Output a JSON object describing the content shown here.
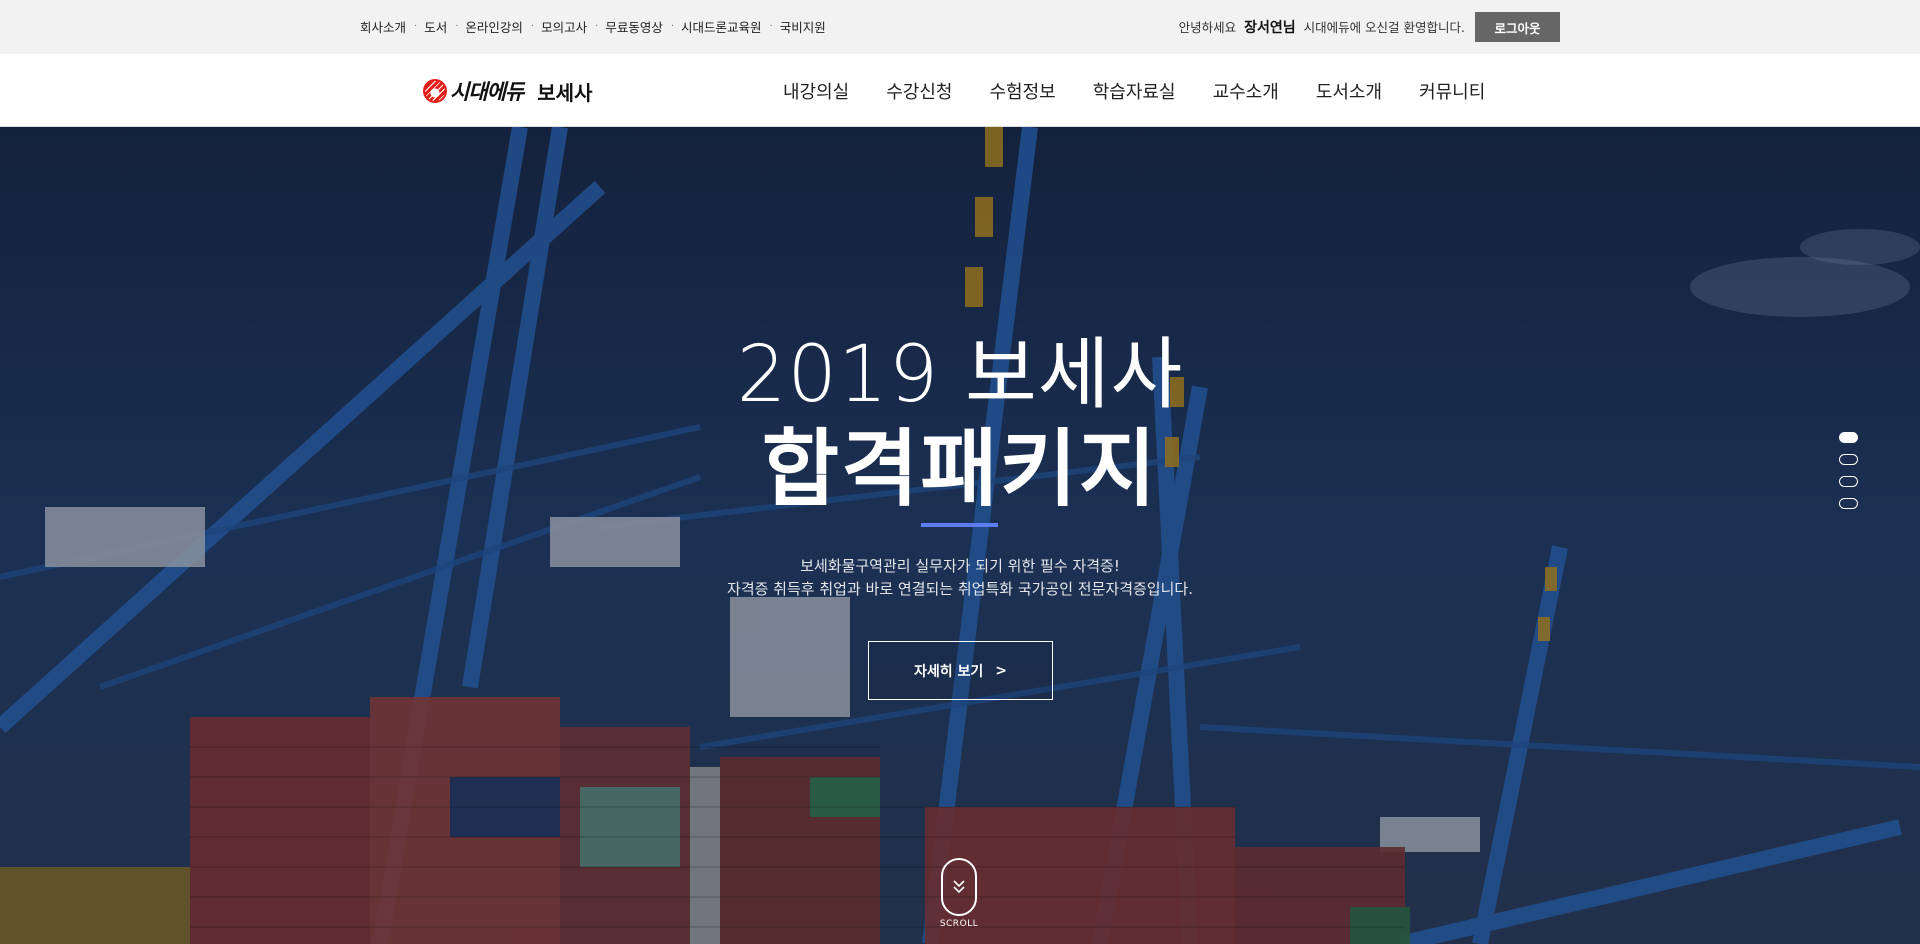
{
  "topbar": {
    "links": [
      "회사소개",
      "도서",
      "온라인강의",
      "모의고사",
      "무료동영상",
      "시대드론교육원",
      "국비지원"
    ],
    "greeting_prefix": "안녕하세요",
    "user_name": "장서연님",
    "greeting_suffix": "시대에듀에 오신걸 환영합니다.",
    "logout_label": "로그아웃"
  },
  "header": {
    "logo_brand": "시대에듀",
    "logo_sub": "보세사",
    "nav": [
      "내강의실",
      "수강신청",
      "수험정보",
      "학습자료실",
      "교수소개",
      "도서소개",
      "커뮤니티"
    ]
  },
  "hero": {
    "title_line1": "2019 보세사",
    "title_line2": "합격패키지",
    "desc_line1": "보세화물구역관리 실무자가 되기 위한 필수 자격증!",
    "desc_line2": "자격증 취득후 취업과 바로 연결되는 취업특화 국가공인 전문자격증입니다.",
    "detail_button": "자세히 보기",
    "detail_chevron": ">",
    "slide_count": 4,
    "active_slide": 1,
    "scroll_label": "SCROLL",
    "accent_color": "#5b7df0"
  },
  "icons": {
    "logo": "sidaeedu-logo-icon",
    "scroll": "mouse-scroll-icon"
  }
}
